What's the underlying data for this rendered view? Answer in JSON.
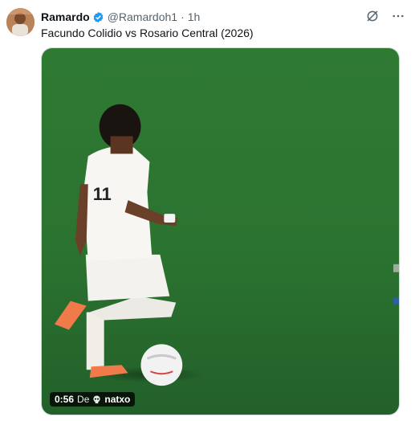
{
  "tweet": {
    "author_name": "Ramardo",
    "handle": "@Ramardoh1",
    "separator": "·",
    "time": "1h",
    "text": "Facundo Colidio vs Rosario Central (2026)"
  },
  "icons": {
    "verified": "verified-badge-icon",
    "grok": "grok-icon",
    "more": "more-options-icon"
  },
  "video": {
    "duration": "0:56",
    "from_label": "De",
    "source": "natxo"
  },
  "colors": {
    "verified_blue": "#1d9bf0",
    "pitch_green": "#2e7d32",
    "text_primary": "#0f1419",
    "text_secondary": "#536471"
  }
}
